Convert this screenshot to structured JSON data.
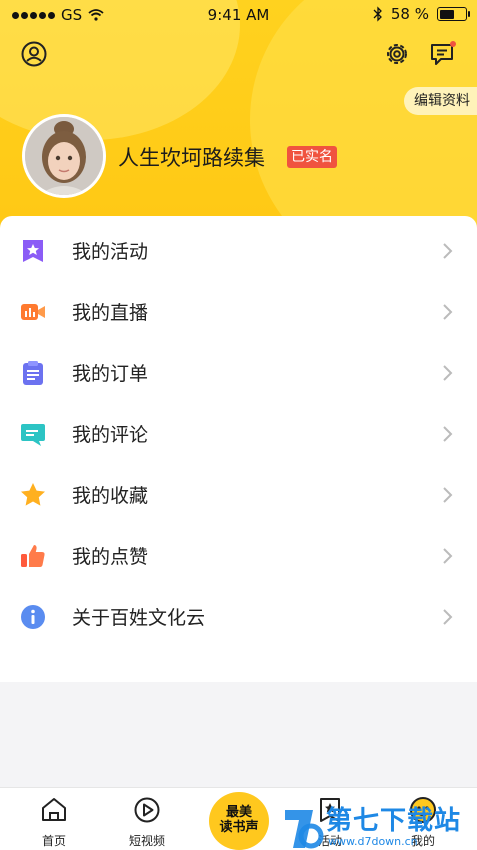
{
  "status_bar": {
    "carrier": "GS",
    "time": "9:41 AM",
    "battery_text": "58 %",
    "battery_level": 0.58
  },
  "header": {
    "edit_profile_label": "编辑资料",
    "username": "人生坎坷路续集",
    "verified_badge": "已实名"
  },
  "menu": [
    {
      "label": "我的活动",
      "icon": "star-badge-icon",
      "color": "#8b5cf6"
    },
    {
      "label": "我的直播",
      "icon": "video-camera-icon",
      "color": "#ff7a2f"
    },
    {
      "label": "我的订单",
      "icon": "clipboard-icon",
      "color": "#6c72f0"
    },
    {
      "label": "我的评论",
      "icon": "comment-icon",
      "color": "#2cc4c4"
    },
    {
      "label": "我的收藏",
      "icon": "star-icon",
      "color": "#ffb020"
    },
    {
      "label": "我的点赞",
      "icon": "thumbs-up-icon",
      "color": "#ff5a3c"
    },
    {
      "label": "关于百姓文化云",
      "icon": "info-icon",
      "color": "#5a8cf0"
    }
  ],
  "tabbar": {
    "home": "首页",
    "short_video": "短视频",
    "center_line1": "最美",
    "center_line2": "读书声",
    "activity": "活动",
    "mine": "我的"
  },
  "watermark": {
    "title": "第七下载站",
    "url": "www.d7down.cn"
  },
  "colors": {
    "accent": "#ffc814",
    "verified_bg": "#f0533f"
  }
}
